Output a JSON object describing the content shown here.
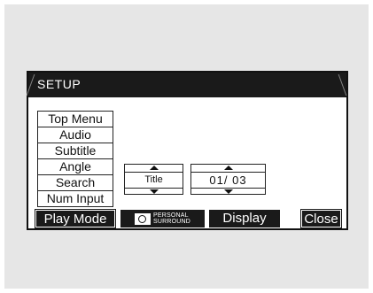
{
  "dialog": {
    "title": "SETUP"
  },
  "menu": {
    "items": [
      {
        "label": "Top Menu"
      },
      {
        "label": "Audio"
      },
      {
        "label": "Subtitle"
      },
      {
        "label": "Angle"
      },
      {
        "label": "Search"
      },
      {
        "label": "Num Input"
      }
    ]
  },
  "search": {
    "mode_value": "Title",
    "number_value": "01/ 03"
  },
  "bottom": {
    "play_mode": "Play Mode",
    "personal_surround_line1": "PERSONAL",
    "personal_surround_line2": "SURROUND",
    "display": "Display",
    "close": "Close"
  }
}
